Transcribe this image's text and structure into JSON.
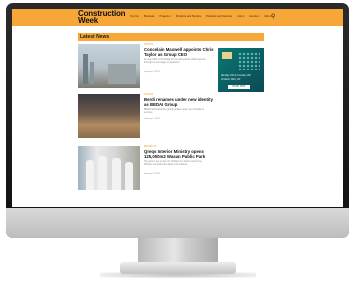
{
  "site": {
    "logo_line1": "Construction",
    "logo_line2": "Week"
  },
  "nav": {
    "items": [
      "Top Cut",
      "Business",
      "Projects ▾",
      "Products and Tenders",
      "Products and Services",
      "Jobs ▾",
      "Events ▾",
      "More ▾"
    ],
    "search_icon": "search-icon"
  },
  "section": {
    "title": "Latest News"
  },
  "ad": {
    "line1": "Monday 13th & Tuesday 14th",
    "line2": "of March 2023, JW",
    "button": "BOOK NOW"
  },
  "articles": [
    {
      "kicker": "PEOPLE",
      "headline": "Concelain Maxwell appoints Chris Taylor as Group CEO",
      "excerpt": "As new CEO of the Dubai firm he will lead the UAE business through its next stage of expansion",
      "date": "January 3, 2023"
    },
    {
      "kicker": "PEOPLE",
      "headline": "Berdi renames under new identity as BEDAI Group",
      "excerpt": "BEDAI will hold all the group entities under one umbrella of services",
      "date": "January 3, 2023"
    },
    {
      "kicker": "PROJECTS",
      "headline": "Qreqs Interior Ministry opens 125,000m2 Wasan Public Park",
      "excerpt": "The park is set to open 17 facilities for visitors across the Minister and parks and plays and outdoors",
      "date": "January 3, 2023"
    }
  ],
  "colors": {
    "accent": "#f6a737",
    "ad_bg": "#0b5c63"
  }
}
